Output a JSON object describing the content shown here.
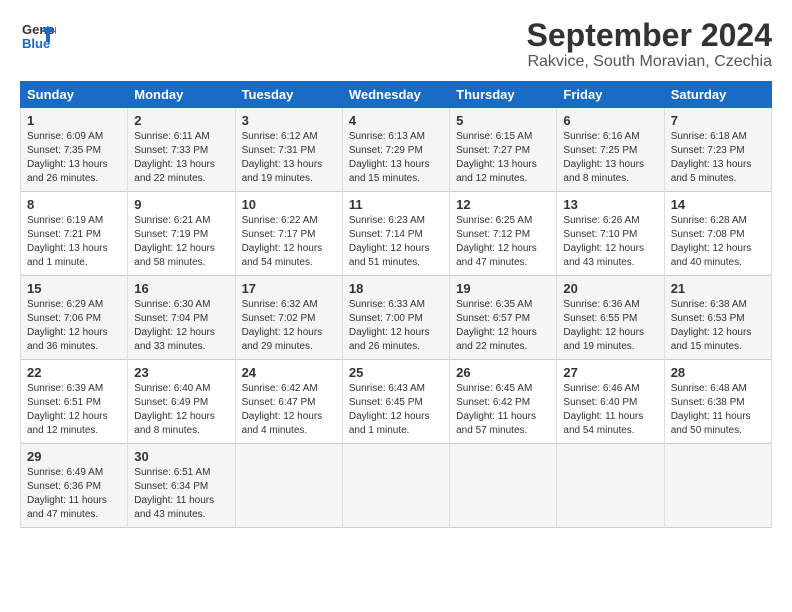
{
  "logo": {
    "line1": "General",
    "line2": "Blue"
  },
  "title": "September 2024",
  "location": "Rakvice, South Moravian, Czechia",
  "weekdays": [
    "Sunday",
    "Monday",
    "Tuesday",
    "Wednesday",
    "Thursday",
    "Friday",
    "Saturday"
  ],
  "rows": [
    [
      {
        "day": "1",
        "info": "Sunrise: 6:09 AM\nSunset: 7:35 PM\nDaylight: 13 hours\nand 26 minutes."
      },
      {
        "day": "2",
        "info": "Sunrise: 6:11 AM\nSunset: 7:33 PM\nDaylight: 13 hours\nand 22 minutes."
      },
      {
        "day": "3",
        "info": "Sunrise: 6:12 AM\nSunset: 7:31 PM\nDaylight: 13 hours\nand 19 minutes."
      },
      {
        "day": "4",
        "info": "Sunrise: 6:13 AM\nSunset: 7:29 PM\nDaylight: 13 hours\nand 15 minutes."
      },
      {
        "day": "5",
        "info": "Sunrise: 6:15 AM\nSunset: 7:27 PM\nDaylight: 13 hours\nand 12 minutes."
      },
      {
        "day": "6",
        "info": "Sunrise: 6:16 AM\nSunset: 7:25 PM\nDaylight: 13 hours\nand 8 minutes."
      },
      {
        "day": "7",
        "info": "Sunrise: 6:18 AM\nSunset: 7:23 PM\nDaylight: 13 hours\nand 5 minutes."
      }
    ],
    [
      {
        "day": "8",
        "info": "Sunrise: 6:19 AM\nSunset: 7:21 PM\nDaylight: 13 hours\nand 1 minute."
      },
      {
        "day": "9",
        "info": "Sunrise: 6:21 AM\nSunset: 7:19 PM\nDaylight: 12 hours\nand 58 minutes."
      },
      {
        "day": "10",
        "info": "Sunrise: 6:22 AM\nSunset: 7:17 PM\nDaylight: 12 hours\nand 54 minutes."
      },
      {
        "day": "11",
        "info": "Sunrise: 6:23 AM\nSunset: 7:14 PM\nDaylight: 12 hours\nand 51 minutes."
      },
      {
        "day": "12",
        "info": "Sunrise: 6:25 AM\nSunset: 7:12 PM\nDaylight: 12 hours\nand 47 minutes."
      },
      {
        "day": "13",
        "info": "Sunrise: 6:26 AM\nSunset: 7:10 PM\nDaylight: 12 hours\nand 43 minutes."
      },
      {
        "day": "14",
        "info": "Sunrise: 6:28 AM\nSunset: 7:08 PM\nDaylight: 12 hours\nand 40 minutes."
      }
    ],
    [
      {
        "day": "15",
        "info": "Sunrise: 6:29 AM\nSunset: 7:06 PM\nDaylight: 12 hours\nand 36 minutes."
      },
      {
        "day": "16",
        "info": "Sunrise: 6:30 AM\nSunset: 7:04 PM\nDaylight: 12 hours\nand 33 minutes."
      },
      {
        "day": "17",
        "info": "Sunrise: 6:32 AM\nSunset: 7:02 PM\nDaylight: 12 hours\nand 29 minutes."
      },
      {
        "day": "18",
        "info": "Sunrise: 6:33 AM\nSunset: 7:00 PM\nDaylight: 12 hours\nand 26 minutes."
      },
      {
        "day": "19",
        "info": "Sunrise: 6:35 AM\nSunset: 6:57 PM\nDaylight: 12 hours\nand 22 minutes."
      },
      {
        "day": "20",
        "info": "Sunrise: 6:36 AM\nSunset: 6:55 PM\nDaylight: 12 hours\nand 19 minutes."
      },
      {
        "day": "21",
        "info": "Sunrise: 6:38 AM\nSunset: 6:53 PM\nDaylight: 12 hours\nand 15 minutes."
      }
    ],
    [
      {
        "day": "22",
        "info": "Sunrise: 6:39 AM\nSunset: 6:51 PM\nDaylight: 12 hours\nand 12 minutes."
      },
      {
        "day": "23",
        "info": "Sunrise: 6:40 AM\nSunset: 6:49 PM\nDaylight: 12 hours\nand 8 minutes."
      },
      {
        "day": "24",
        "info": "Sunrise: 6:42 AM\nSunset: 6:47 PM\nDaylight: 12 hours\nand 4 minutes."
      },
      {
        "day": "25",
        "info": "Sunrise: 6:43 AM\nSunset: 6:45 PM\nDaylight: 12 hours\nand 1 minute."
      },
      {
        "day": "26",
        "info": "Sunrise: 6:45 AM\nSunset: 6:42 PM\nDaylight: 11 hours\nand 57 minutes."
      },
      {
        "day": "27",
        "info": "Sunrise: 6:46 AM\nSunset: 6:40 PM\nDaylight: 11 hours\nand 54 minutes."
      },
      {
        "day": "28",
        "info": "Sunrise: 6:48 AM\nSunset: 6:38 PM\nDaylight: 11 hours\nand 50 minutes."
      }
    ],
    [
      {
        "day": "29",
        "info": "Sunrise: 6:49 AM\nSunset: 6:36 PM\nDaylight: 11 hours\nand 47 minutes."
      },
      {
        "day": "30",
        "info": "Sunrise: 6:51 AM\nSunset: 6:34 PM\nDaylight: 11 hours\nand 43 minutes."
      },
      {
        "day": "",
        "info": ""
      },
      {
        "day": "",
        "info": ""
      },
      {
        "day": "",
        "info": ""
      },
      {
        "day": "",
        "info": ""
      },
      {
        "day": "",
        "info": ""
      }
    ]
  ]
}
